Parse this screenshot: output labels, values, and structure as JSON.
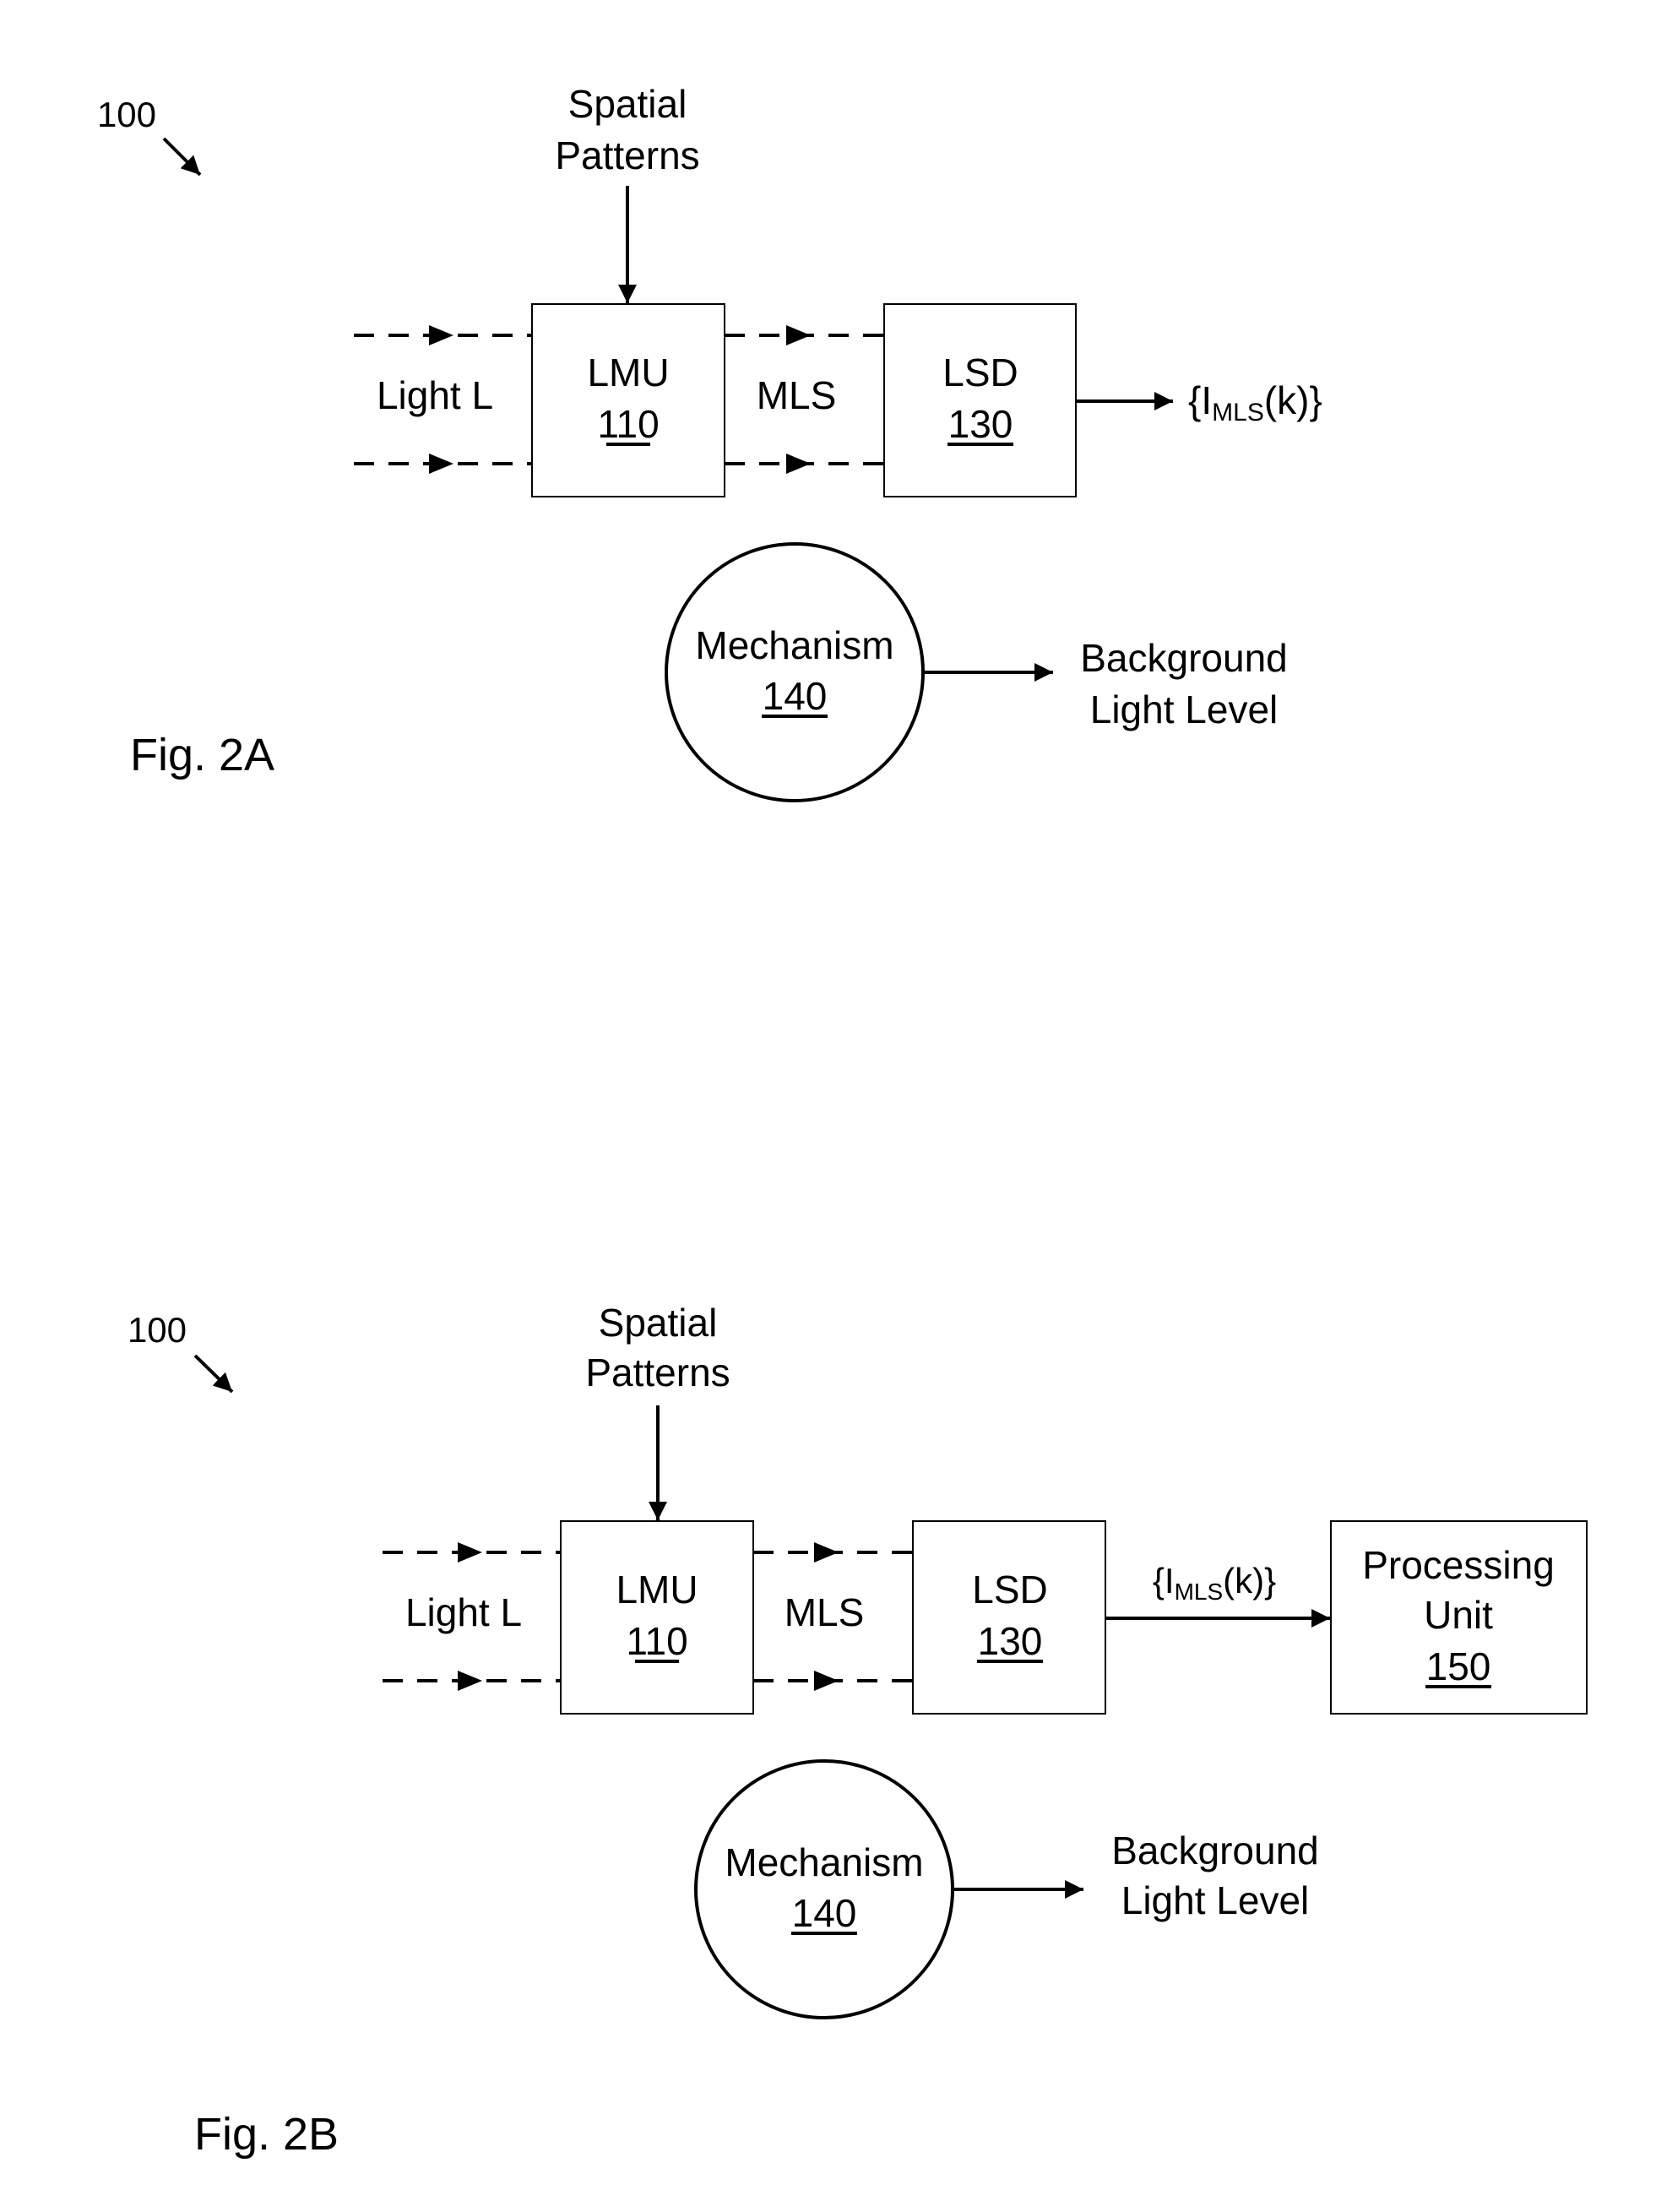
{
  "figures": [
    {
      "id": "fig2a",
      "caption": "Fig. 2A",
      "ref_label": "100",
      "spatial_patterns": [
        "Spatial",
        "Patterns"
      ],
      "input_label": "Light L",
      "lmu": {
        "name": "LMU",
        "ref": "110"
      },
      "between_label": "MLS",
      "lsd": {
        "name": "LSD",
        "ref": "130"
      },
      "output": {
        "prefix": "{I",
        "subscript": "MLS",
        "suffix": "(k)}"
      },
      "mechanism": {
        "name": "Mechanism",
        "ref": "140"
      },
      "mechanism_output": [
        "Background",
        "Light Level"
      ]
    },
    {
      "id": "fig2b",
      "caption": "Fig. 2B",
      "ref_label": "100",
      "spatial_patterns": [
        "Spatial",
        "Patterns"
      ],
      "input_label": "Light L",
      "lmu": {
        "name": "LMU",
        "ref": "110"
      },
      "between_label": "MLS",
      "lsd": {
        "name": "LSD",
        "ref": "130"
      },
      "output": {
        "prefix": "{I",
        "subscript": "MLS",
        "suffix": "(k)}"
      },
      "processing_unit": {
        "name": [
          "Processing",
          "Unit"
        ],
        "ref": "150"
      },
      "mechanism": {
        "name": "Mechanism",
        "ref": "140"
      },
      "mechanism_output": [
        "Background",
        "Light Level"
      ]
    }
  ]
}
